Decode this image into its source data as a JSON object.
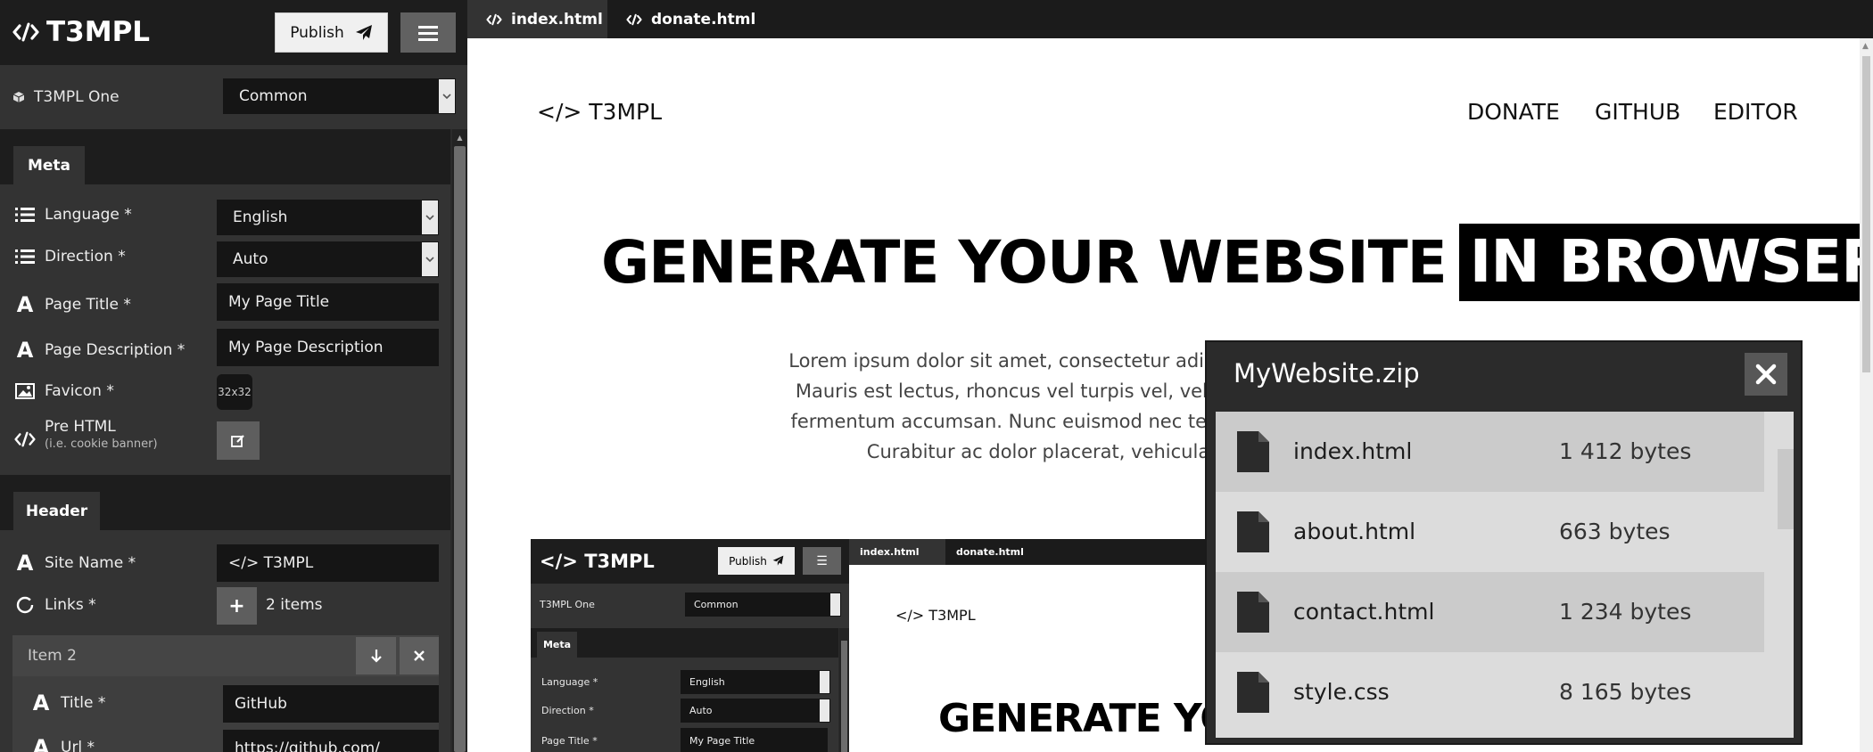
{
  "app": {
    "brand": "T3MPL",
    "publish_label": "Publish"
  },
  "template": {
    "label": "T3MPL One",
    "selected": "Common"
  },
  "sections": {
    "meta": {
      "tab": "Meta",
      "fields": {
        "language": {
          "label": "Language *",
          "value": "English"
        },
        "direction": {
          "label": "Direction *",
          "value": "Auto"
        },
        "page_title": {
          "label": "Page Title *",
          "value": "My Page Title"
        },
        "page_description": {
          "label": "Page Description *",
          "value": "My Page Description"
        },
        "favicon": {
          "label": "Favicon *",
          "placeholder": "32x32"
        },
        "pre_html": {
          "label": "Pre HTML",
          "hint": "(i.e. cookie banner)"
        }
      }
    },
    "header": {
      "tab": "Header",
      "fields": {
        "site_name": {
          "label": "Site Name *",
          "value": "</> T3MPL"
        },
        "links": {
          "label": "Links *",
          "count": "2 items"
        }
      },
      "item": {
        "label": "Item 2",
        "title": {
          "label": "Title *",
          "value": "GitHub"
        },
        "url": {
          "label": "Url *",
          "value": "https://github.com/"
        }
      }
    }
  },
  "editor": {
    "tabs": [
      {
        "label": "index.html"
      },
      {
        "label": "donate.html"
      }
    ]
  },
  "preview": {
    "logo": "</> T3MPL",
    "nav": [
      "DONATE",
      "GITHUB",
      "EDITOR"
    ],
    "hero_title": "GENERATE YOUR WEBSITE",
    "hero_highlight": "IN BROWSER",
    "hero_lines": [
      "Lorem ipsum dolor sit amet, consectetur adipiscing e",
      "Mauris est lectus, rhoncus vel turpis vel, vehicula lo",
      "fermentum accumsan. Nunc euismod nec tellus a im",
      "Curabitur ac dolor placerat, vehicula"
    ],
    "mini": {
      "brand": "T3MPL",
      "publish": "Publish",
      "template": "T3MPL One",
      "template_value": "Common",
      "meta_tab": "Meta",
      "rows": [
        {
          "label": "Language *",
          "value": "English"
        },
        {
          "label": "Direction *",
          "value": "Auto"
        },
        {
          "label": "Page Title *",
          "value": "My Page Title"
        }
      ],
      "tabs": [
        "index.html",
        "donate.html"
      ],
      "logo": "</> T3MPL",
      "hero": "GENERATE YO"
    }
  },
  "zip": {
    "title": "MyWebsite.zip",
    "files": [
      {
        "name": "index.html",
        "size": "1 412 bytes"
      },
      {
        "name": "about.html",
        "size": "663 bytes"
      },
      {
        "name": "contact.html",
        "size": "1 234 bytes"
      },
      {
        "name": "style.css",
        "size": "8 165 bytes"
      }
    ]
  }
}
